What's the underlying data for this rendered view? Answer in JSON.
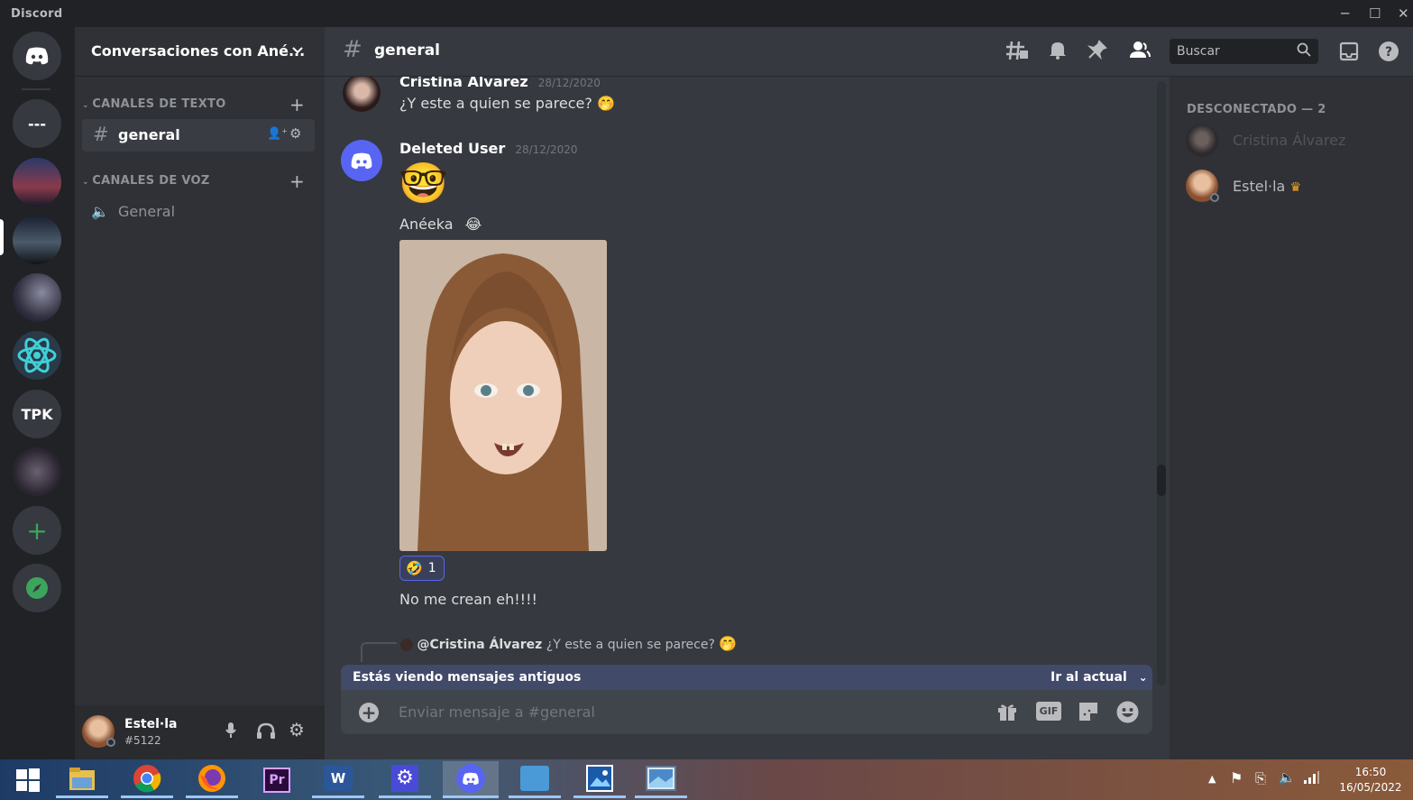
{
  "titlebar": {
    "brand": "Discord",
    "minimize": "─",
    "maximize": "☐",
    "close": "✕"
  },
  "servers": {
    "dm_icon": "discord-logo-icon",
    "s1_label": "---",
    "tpk_label": "TPK",
    "add_label": "+",
    "explore_icon": "compass-icon"
  },
  "guild": {
    "name": "Conversaciones con Ané...",
    "chevron": "⌄"
  },
  "categories": {
    "text": {
      "label": "CANALES DE TEXTO",
      "add": "+"
    },
    "voice": {
      "label": "CANALES DE VOZ",
      "add": "+"
    }
  },
  "channels": {
    "general_text": {
      "hash": "#",
      "name": "general"
    },
    "general_voice": {
      "icon": "🔈",
      "name": "General"
    }
  },
  "user": {
    "name": "Estel·la",
    "tag": "#5122"
  },
  "chat_header": {
    "hash": "#",
    "name": "general",
    "search_placeholder": "Buscar"
  },
  "messages": {
    "m1": {
      "author": "Cristina Álvarez",
      "date": "28/12/2020",
      "text": "¿Y este a quien se parece?",
      "emoji": "🤭"
    },
    "m2": {
      "author": "Deleted User",
      "date": "28/12/2020",
      "big_emoji": "🤓",
      "line1": "Anéeka",
      "line1_emoji": "😂",
      "reaction_emoji": "🤣",
      "reaction_count": "1",
      "line2": "No me crean eh!!!!"
    },
    "reply": {
      "mention": "@Cristina Álvarez",
      "text": "¿Y este a quien se parece?",
      "emoji": "🤭"
    }
  },
  "old_messages": {
    "text": "Estás viendo mensajes antiguos",
    "jump": "Ir al actual",
    "chevron": "⌄"
  },
  "composer": {
    "placeholder": "Enviar mensaje a #general",
    "gif": "GIF"
  },
  "members": {
    "section": "DESCONECTADO — 2",
    "m1": "Cristina Álvarez",
    "m2": "Estel·la",
    "crown": "♛"
  },
  "taskbar": {
    "time": "16:50",
    "date": "16/05/2022",
    "pr_label": "Pr",
    "word_label": "W"
  },
  "colors": {
    "blurple": "#5865f2",
    "green": "#3ba55d",
    "bg": "#36393f",
    "sidebar": "#2f3136"
  }
}
